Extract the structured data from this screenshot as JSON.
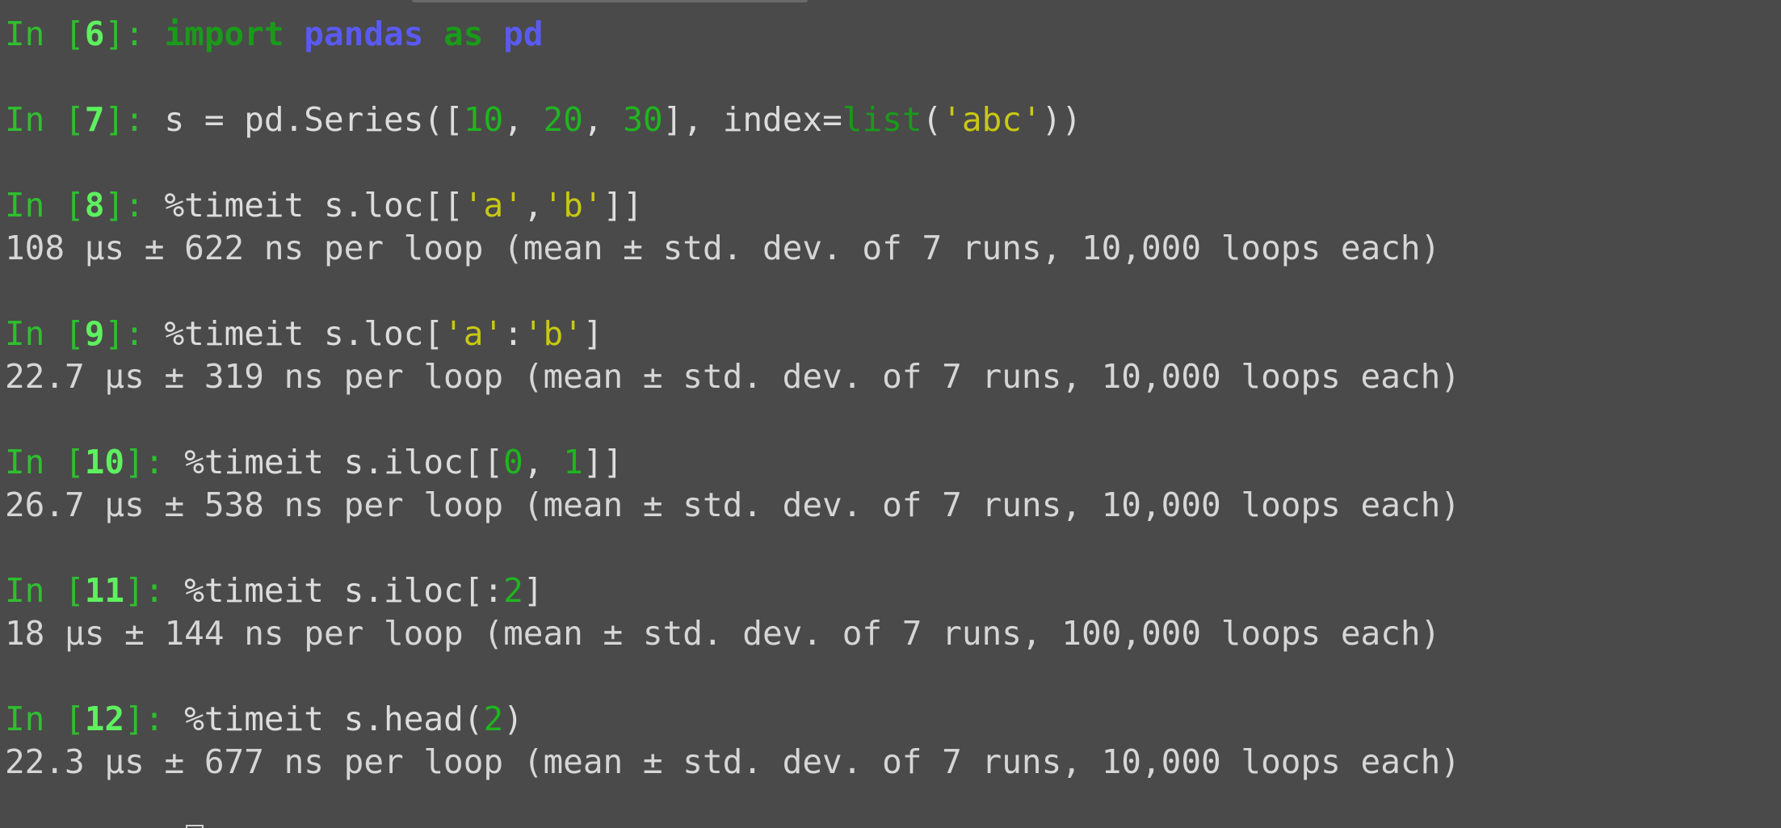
{
  "cells": [
    {
      "prompt_prefix": "In [",
      "number": "6",
      "prompt_suffix": "]: ",
      "tokens": [
        {
          "t": "kw",
          "v": "import"
        },
        {
          "t": "code",
          "v": " "
        },
        {
          "t": "mod",
          "v": "pandas"
        },
        {
          "t": "code",
          "v": " "
        },
        {
          "t": "kw",
          "v": "as"
        },
        {
          "t": "code",
          "v": " "
        },
        {
          "t": "mod",
          "v": "pd"
        }
      ],
      "output": ""
    },
    {
      "prompt_prefix": "In [",
      "number": "7",
      "prompt_suffix": "]: ",
      "tokens": [
        {
          "t": "code",
          "v": "s = pd.Series(["
        },
        {
          "t": "num",
          "v": "10"
        },
        {
          "t": "code",
          "v": ", "
        },
        {
          "t": "num",
          "v": "20"
        },
        {
          "t": "code",
          "v": ", "
        },
        {
          "t": "num",
          "v": "30"
        },
        {
          "t": "code",
          "v": "], index="
        },
        {
          "t": "builtin",
          "v": "list"
        },
        {
          "t": "code",
          "v": "("
        },
        {
          "t": "str",
          "v": "'abc'"
        },
        {
          "t": "code",
          "v": "))"
        }
      ],
      "output": ""
    },
    {
      "prompt_prefix": "In [",
      "number": "8",
      "prompt_suffix": "]: ",
      "tokens": [
        {
          "t": "code",
          "v": "%timeit s.loc[["
        },
        {
          "t": "str",
          "v": "'a'"
        },
        {
          "t": "code",
          "v": ","
        },
        {
          "t": "str",
          "v": "'b'"
        },
        {
          "t": "code",
          "v": "]]"
        }
      ],
      "output": "108 µs ± 622 ns per loop (mean ± std. dev. of 7 runs, 10,000 loops each)"
    },
    {
      "prompt_prefix": "In [",
      "number": "9",
      "prompt_suffix": "]: ",
      "tokens": [
        {
          "t": "code",
          "v": "%timeit s.loc["
        },
        {
          "t": "str",
          "v": "'a'"
        },
        {
          "t": "code",
          "v": ":"
        },
        {
          "t": "str",
          "v": "'b'"
        },
        {
          "t": "code",
          "v": "]"
        }
      ],
      "output": "22.7 µs ± 319 ns per loop (mean ± std. dev. of 7 runs, 10,000 loops each)"
    },
    {
      "prompt_prefix": "In [",
      "number": "10",
      "prompt_suffix": "]: ",
      "tokens": [
        {
          "t": "code",
          "v": "%timeit s.iloc[["
        },
        {
          "t": "num",
          "v": "0"
        },
        {
          "t": "code",
          "v": ", "
        },
        {
          "t": "num",
          "v": "1"
        },
        {
          "t": "code",
          "v": "]]"
        }
      ],
      "output": "26.7 µs ± 538 ns per loop (mean ± std. dev. of 7 runs, 10,000 loops each)"
    },
    {
      "prompt_prefix": "In [",
      "number": "11",
      "prompt_suffix": "]: ",
      "tokens": [
        {
          "t": "code",
          "v": "%timeit s.iloc[:"
        },
        {
          "t": "num",
          "v": "2"
        },
        {
          "t": "code",
          "v": "]"
        }
      ],
      "output": "18 µs ± 144 ns per loop (mean ± std. dev. of 7 runs, 100,000 loops each)"
    },
    {
      "prompt_prefix": "In [",
      "number": "12",
      "prompt_suffix": "]: ",
      "tokens": [
        {
          "t": "code",
          "v": "%timeit s.head("
        },
        {
          "t": "num",
          "v": "2"
        },
        {
          "t": "code",
          "v": ")"
        }
      ],
      "output": "22.3 µs ± 677 ns per loop (mean ± std. dev. of 7 runs, 10,000 loops each)"
    }
  ],
  "colors": {
    "background": "#4a4a4a",
    "prompt": "#2fbf2f",
    "prompt_number": "#5ff05f",
    "keyword": "#1a9a1a",
    "module": "#5a5af0",
    "number": "#1fb51f",
    "string": "#c8c814",
    "text": "#dcdcdc"
  }
}
